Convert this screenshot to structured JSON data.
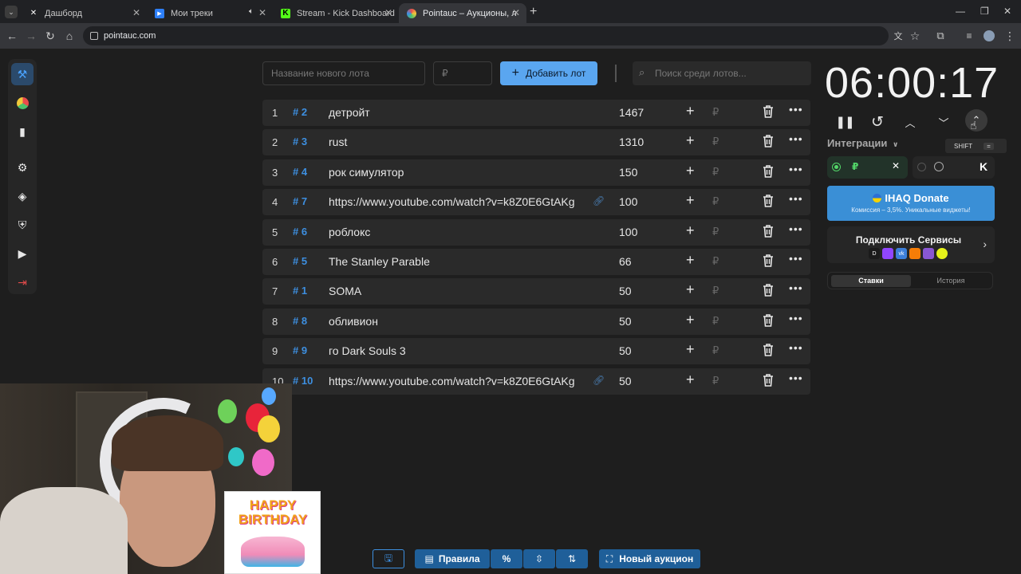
{
  "browser": {
    "tabs": [
      {
        "title": "Дашборд",
        "icon": "x-icon"
      },
      {
        "title": "Мои треки",
        "icon": "play-icon"
      },
      {
        "title": "Stream - Kick Dashboard",
        "icon": "kick-icon"
      },
      {
        "title": "Pointauc – Аукционы, лотереи",
        "icon": "pointauc-icon"
      }
    ],
    "url": "pointauc.com"
  },
  "toolbar": {
    "new_lot_placeholder": "Название нового лота",
    "amount_placeholder": "₽",
    "add_lot_label": "Добавить лот",
    "search_placeholder": "Поиск среди лотов..."
  },
  "lots": [
    {
      "rank": "1",
      "id": "# 2",
      "name": "детройт",
      "amount": "1467",
      "is_link": false
    },
    {
      "rank": "2",
      "id": "# 3",
      "name": "rust",
      "amount": "1310",
      "is_link": false
    },
    {
      "rank": "3",
      "id": "# 4",
      "name": "рок симулятор",
      "amount": "150",
      "is_link": false
    },
    {
      "rank": "4",
      "id": "# 7",
      "name": "https://www.youtube.com/watch?v=k8Z0E6GtAKg",
      "amount": "100",
      "is_link": true
    },
    {
      "rank": "5",
      "id": "# 6",
      "name": "роблокс",
      "amount": "100",
      "is_link": false
    },
    {
      "rank": "6",
      "id": "# 5",
      "name": "The Stanley Parable",
      "amount": "66",
      "is_link": false
    },
    {
      "rank": "7",
      "id": "# 1",
      "name": "SOMA",
      "amount": "50",
      "is_link": false
    },
    {
      "rank": "8",
      "id": "# 8",
      "name": "обливион",
      "amount": "50",
      "is_link": false
    },
    {
      "rank": "9",
      "id": "# 9",
      "name": "го Dark Souls 3",
      "amount": "50",
      "is_link": false
    },
    {
      "rank": "10",
      "id": "# 10",
      "name": "https://www.youtube.com/watch?v=k8Z0E6GtAKg",
      "amount": "50",
      "is_link": true
    }
  ],
  "row_rub": "₽",
  "timer": {
    "value": "06:00:17",
    "shift_hint": "SHIFT",
    "shift_hint2": "="
  },
  "integrations": {
    "label": "Интеграции",
    "donate_title": "IHAQ Donate",
    "donate_subtitle": "Комиссия – 3,5%. Уникальные виджеты!",
    "connect_label": "Подключить Сервисы",
    "tab_bets": "Ставки",
    "tab_history": "История"
  },
  "bottom": {
    "rules": "Правила",
    "percent": "%",
    "new_auction": "Новый аукцион"
  },
  "overlay": {
    "birthday_text": "HAPPY BIRTHDAY"
  },
  "colors": {
    "accent": "#5aa6f0",
    "id_blue": "#3d8fe0",
    "bg": "#1e1e1e",
    "row_bg": "#2a2a2a"
  }
}
